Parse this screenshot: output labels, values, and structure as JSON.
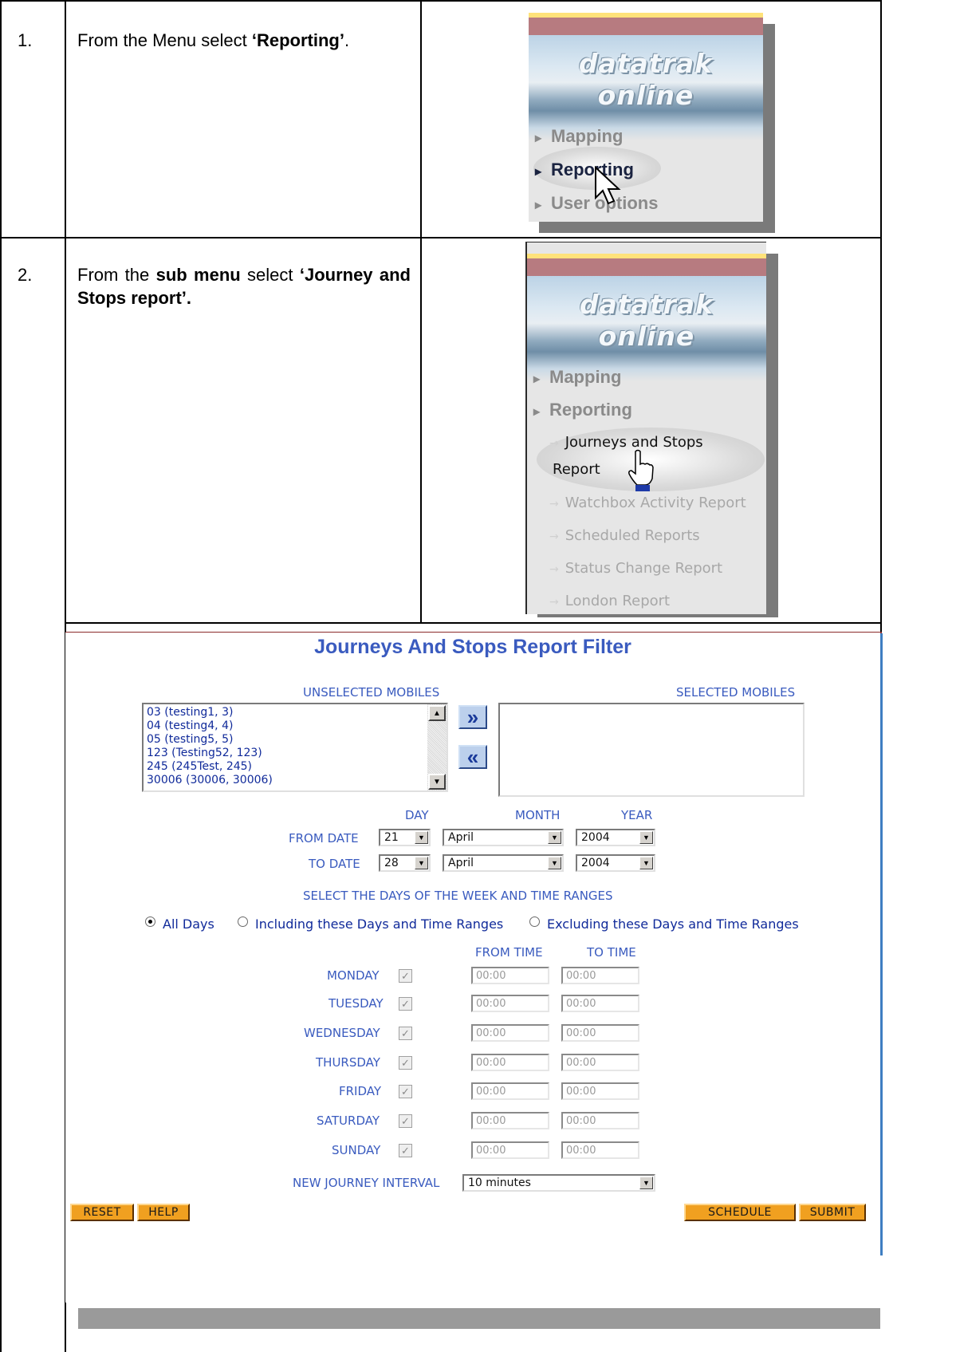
{
  "steps": [
    {
      "number": "1.",
      "text_prefix": "From the Menu select ",
      "text_bold": "‘Reporting’",
      "text_suffix": "."
    },
    {
      "number": "2.",
      "text_prefix": "From the ",
      "text_bold": "sub menu",
      "text_mid": " select ",
      "text_bold2": "‘Journey and Stops report’."
    }
  ],
  "menu": {
    "brand_line1": "datatrak",
    "brand_line2": "online",
    "items": [
      "Mapping",
      "Reporting",
      "User options"
    ],
    "submenu": [
      {
        "label": "Journeys and Stops",
        "label2": "Report"
      },
      {
        "label": "Watchbox Activity Report"
      },
      {
        "label": "Scheduled Reports"
      },
      {
        "label": "Status Change Report"
      },
      {
        "label": "London Report"
      }
    ]
  },
  "form": {
    "title": "Journeys And Stops Report Filter",
    "unselected_label": "UNSELECTED MOBILES",
    "selected_label": "SELECTED MOBILES",
    "unselected_mobiles": [
      "03 (testing1, 3)",
      "04 (testing4, 4)",
      "05 (testing5, 5)",
      "123 (Testing52, 123)",
      "245 (245Test, 245)",
      "30006 (30006, 30006)"
    ],
    "add_button": "»",
    "remove_button": "«",
    "day_label": "DAY",
    "month_label": "MONTH",
    "year_label": "YEAR",
    "from_date_label": "FROM DATE",
    "to_date_label": "TO DATE",
    "from_date": {
      "day": "21",
      "month": "April",
      "year": "2004"
    },
    "to_date": {
      "day": "28",
      "month": "April",
      "year": "2004"
    },
    "days_heading": "SELECT THE DAYS OF THE WEEK AND TIME RANGES",
    "radio_options": [
      "All Days",
      "Including these Days and Time Ranges",
      "Excluding these Days and Time Ranges"
    ],
    "radio_selected": "All Days",
    "from_time_label": "FROM TIME",
    "to_time_label": "TO TIME",
    "days": [
      {
        "name": "MONDAY",
        "from": "00:00",
        "to": "00:00"
      },
      {
        "name": "TUESDAY",
        "from": "00:00",
        "to": "00:00"
      },
      {
        "name": "WEDNESDAY",
        "from": "00:00",
        "to": "00:00"
      },
      {
        "name": "THURSDAY",
        "from": "00:00",
        "to": "00:00"
      },
      {
        "name": "FRIDAY",
        "from": "00:00",
        "to": "00:00"
      },
      {
        "name": "SATURDAY",
        "from": "00:00",
        "to": "00:00"
      },
      {
        "name": "SUNDAY",
        "from": "00:00",
        "to": "00:00"
      }
    ],
    "interval_label": "NEW JOURNEY INTERVAL",
    "interval_value": "10 minutes",
    "buttons": {
      "reset": "RESET",
      "help": "HELP",
      "schedule": "SCHEDULE",
      "submit": "SUBMIT"
    }
  }
}
